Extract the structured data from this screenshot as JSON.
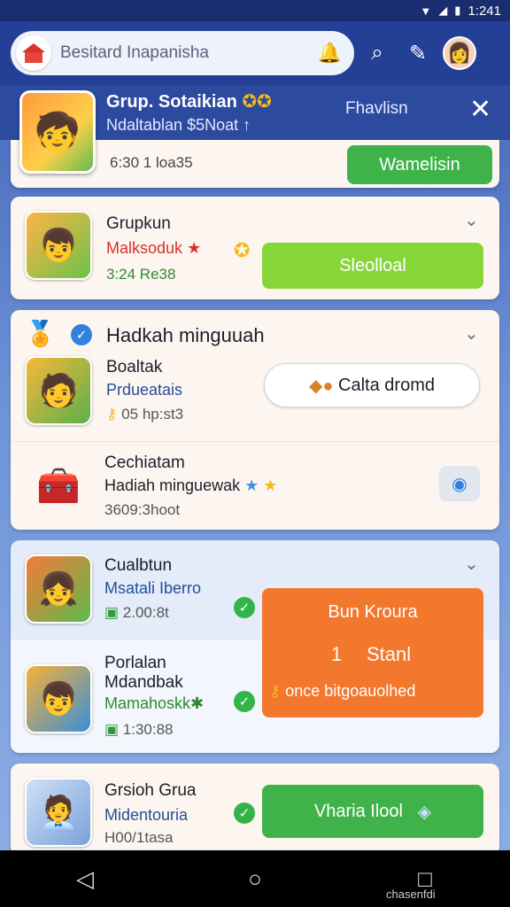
{
  "status_bar": {
    "time": "1:241"
  },
  "search": {
    "placeholder": "Besitard Inapanisha"
  },
  "banner": {
    "title": "Grup. Sotaikian",
    "subtitle": "Ndaltablan $5Noat",
    "action_label": "Fhavlisn",
    "close_glyph": "✕"
  },
  "card1": {
    "meta": "6:30 1 loa35",
    "button_label": "Wamelisin",
    "button_color": "#3fb34a"
  },
  "card2": {
    "name": "Grupkun",
    "subtitle": "Malksoduk",
    "meta": "3:24 Re38",
    "button_label": "Sleolloal",
    "button_color": "#86d63a"
  },
  "card3": {
    "section_title": "Hadkah minguuah",
    "item1": {
      "name": "Boaltak",
      "subtitle": "Prdueatais",
      "meta": "05 hp:st3",
      "button_label": "Calta dromd"
    },
    "item2": {
      "name": "Cechiatam",
      "subtitle": "Hadiah minguewak",
      "meta": "3609:3hoot"
    }
  },
  "card4": {
    "item1": {
      "name": "Cualbtun",
      "subtitle": "Msatali Iberro",
      "meta": "2.00:8t"
    },
    "item2": {
      "name": "Porlalan",
      "name2": "Mdandbak",
      "subtitle": "Mamahoskk",
      "meta": "1:30:88"
    },
    "promo": {
      "title": "Bun Kroura",
      "count_label": "1",
      "action_label": "Stanl",
      "footer_label": "once bitgoauolhed",
      "color": "#f3782e"
    }
  },
  "card5": {
    "name": "Grsioh Grua",
    "subtitle": "Midentouria",
    "meta": "H00/1tasa",
    "button_label": "Vharia Ilool",
    "button_color": "#3fb34a"
  },
  "navbar": {
    "caption": "chasenfdi"
  }
}
